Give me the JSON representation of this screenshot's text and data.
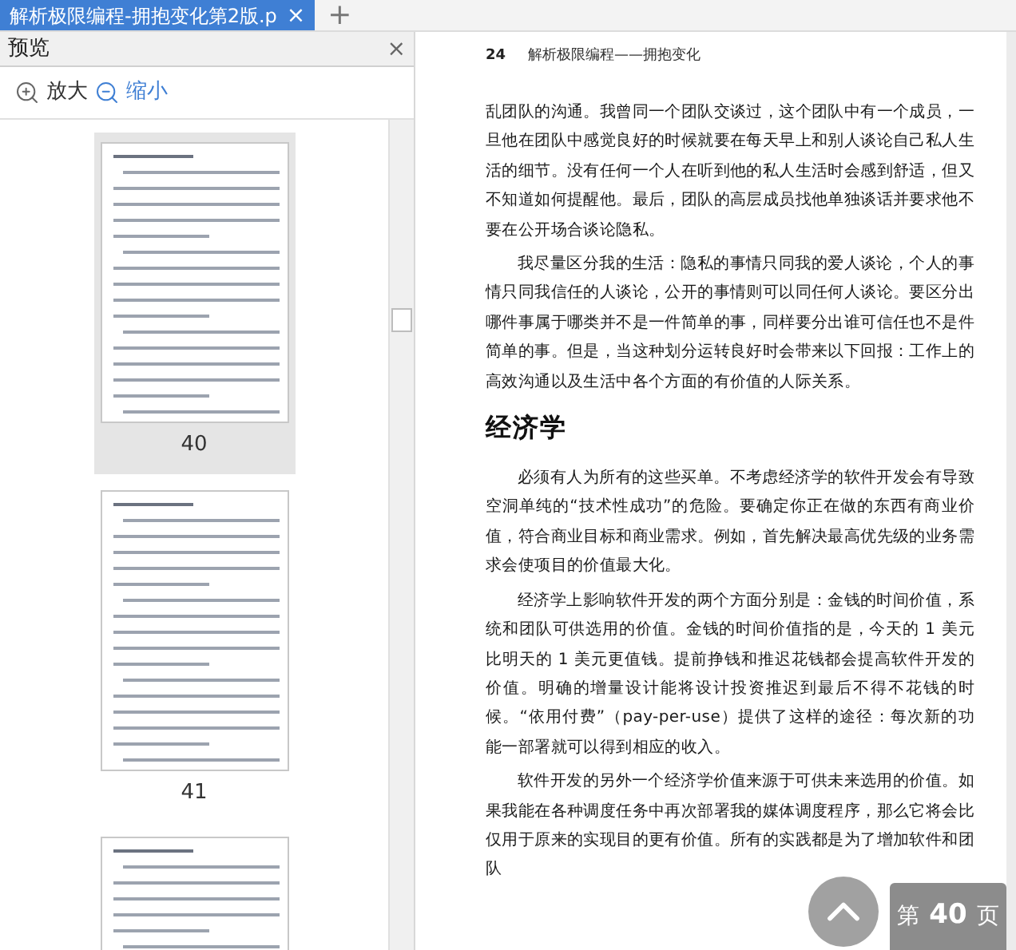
{
  "tab": {
    "title": "解析极限编程-拥抱变化第2版.p",
    "close": "×",
    "new_tab": "+"
  },
  "preview_panel": {
    "title": "预览",
    "close": "×",
    "zoom_in": "放大",
    "zoom_out": "缩小",
    "thumbnails": [
      {
        "label": "40",
        "selected": true
      },
      {
        "label": "41",
        "selected": false
      },
      {
        "selected": false
      }
    ]
  },
  "page": {
    "number": "24",
    "running_title": "解析极限编程——拥抱变化",
    "blocks": [
      {
        "kind": "paragraph",
        "indent": false,
        "text": "乱团队的沟通。我曾同一个团队交谈过，这个团队中有一个成员，一旦他在团队中感觉良好的时候就要在每天早上和别人谈论自己私人生活的细节。没有任何一个人在听到他的私人生活时会感到舒适，但又不知道如何提醒他。最后，团队的高层成员找他单独谈话并要求他不要在公开场合谈论隐私。"
      },
      {
        "kind": "paragraph",
        "indent": true,
        "text": "我尽量区分我的生活：隐私的事情只同我的爱人谈论，个人的事情只同我信任的人谈论，公开的事情则可以同任何人谈论。要区分出哪件事属于哪类并不是一件简单的事，同样要分出谁可信任也不是件简单的事。但是，当这种划分运转良好时会带来以下回报：工作上的高效沟通以及生活中各个方面的有价值的人际关系。"
      },
      {
        "kind": "heading",
        "text": "经济学"
      },
      {
        "kind": "paragraph",
        "indent": true,
        "text": "必须有人为所有的这些买单。不考虑经济学的软件开发会有导致空洞单纯的“技术性成功”的危险。要确定你正在做的东西有商业价值，符合商业目标和商业需求。例如，首先解决最高优先级的业务需求会使项目的价值最大化。"
      },
      {
        "kind": "paragraph",
        "indent": true,
        "text": "经济学上影响软件开发的两个方面分别是：金钱的时间价值，系统和团队可供选用的价值。金钱的时间价值指的是，今天的 1 美元比明天的 1 美元更值钱。提前挣钱和推迟花钱都会提高软件开发的价值。明确的增量设计能将设计投资推迟到最后不得不花钱的时候。“依用付费”（pay-per-use）提供了这样的途径：每次新的功能一部署就可以得到相应的收入。"
      },
      {
        "kind": "paragraph",
        "indent": true,
        "text": "软件开发的另外一个经济学价值来源于可供未来选用的价值。如果我能在各种调度任务中再次部署我的媒体调度程序，那么它将会比仅用于原来的实现目的更有价值。所有的实践都是为了增加软件和团队"
      }
    ]
  },
  "page_indicator": {
    "prefix": "第",
    "number": "40",
    "suffix": "页"
  }
}
